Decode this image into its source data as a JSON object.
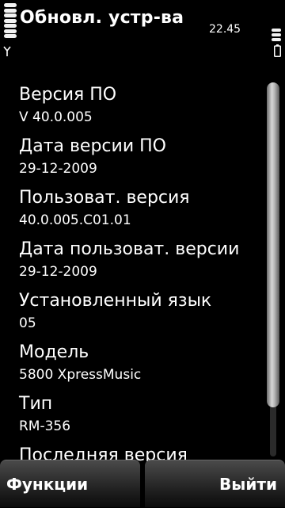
{
  "status_bar": {
    "title": "Обновл. устр-ва",
    "time": "22.45",
    "signal_icon": "antenna-icon",
    "battery_icon": "battery-icon"
  },
  "info_items": [
    {
      "label": "Версия ПО",
      "value": "V 40.0.005"
    },
    {
      "label": "Дата версии ПО",
      "value": "29-12-2009"
    },
    {
      "label": "Пользоват. версия",
      "value": "40.0.005.C01.01"
    },
    {
      "label": "Дата пользоват. версии",
      "value": "29-12-2009"
    },
    {
      "label": "Установленный язык",
      "value": "05"
    },
    {
      "label": "Модель",
      "value": "5800 XpressMusic"
    },
    {
      "label": "Тип",
      "value": "RM-356"
    },
    {
      "label": "Последняя версия",
      "value": ""
    }
  ],
  "softkeys": {
    "left": "Функции",
    "right": "Выйти"
  }
}
